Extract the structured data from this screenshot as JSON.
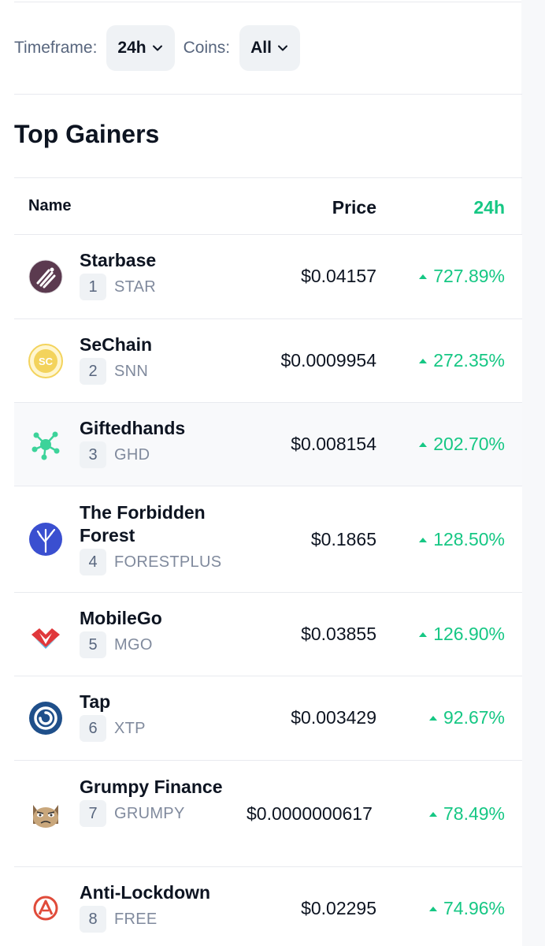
{
  "filters": {
    "timeframe_label": "Timeframe:",
    "timeframe_value": "24h",
    "coins_label": "Coins:",
    "coins_value": "All"
  },
  "section_title": "Top Gainers",
  "table": {
    "headers": {
      "name": "Name",
      "price": "Price",
      "change": "24h"
    },
    "rows": [
      {
        "name": "Starbase",
        "rank": "1",
        "symbol": "STAR",
        "price": "$0.04157",
        "change": "727.89%",
        "icon": "starbase-logo",
        "color": "#5b3a4f"
      },
      {
        "name": "SeChain",
        "rank": "2",
        "symbol": "SNN",
        "price": "$0.0009954",
        "change": "272.35%",
        "icon": "sechain-logo",
        "color": "#f3d35c"
      },
      {
        "name": "Giftedhands",
        "rank": "3",
        "symbol": "GHD",
        "price": "$0.008154",
        "change": "202.70%",
        "icon": "giftedhands-logo",
        "color": "#3dd39a"
      },
      {
        "name": "The Forbidden Forest",
        "rank": "4",
        "symbol": "FORESTPLUS",
        "price": "$0.1865",
        "change": "128.50%",
        "icon": "forbidden-forest-logo",
        "color": "#3a4fd0"
      },
      {
        "name": "MobileGo",
        "rank": "5",
        "symbol": "MGO",
        "price": "$0.03855",
        "change": "126.90%",
        "icon": "mobilego-logo",
        "color": "#e0383b"
      },
      {
        "name": "Tap",
        "rank": "6",
        "symbol": "XTP",
        "price": "$0.003429",
        "change": "92.67%",
        "icon": "tap-logo",
        "color": "#1f4f8a"
      },
      {
        "name": "Grumpy Finance",
        "rank": "7",
        "symbol": "GRUMPY",
        "price": "$0.0000000617",
        "change": "78.49%",
        "icon": "grumpy-cat-logo",
        "color": "#8a6a4a"
      },
      {
        "name": "Anti-Lockdown",
        "rank": "8",
        "symbol": "FREE",
        "price": "$0.02295",
        "change": "74.96%",
        "icon": "anti-lockdown-logo",
        "color": "#e04b3a"
      }
    ]
  },
  "colors": {
    "positive": "#16c784",
    "text": "#0d1421",
    "muted": "#58667e",
    "chip_bg": "#eff2f5"
  }
}
